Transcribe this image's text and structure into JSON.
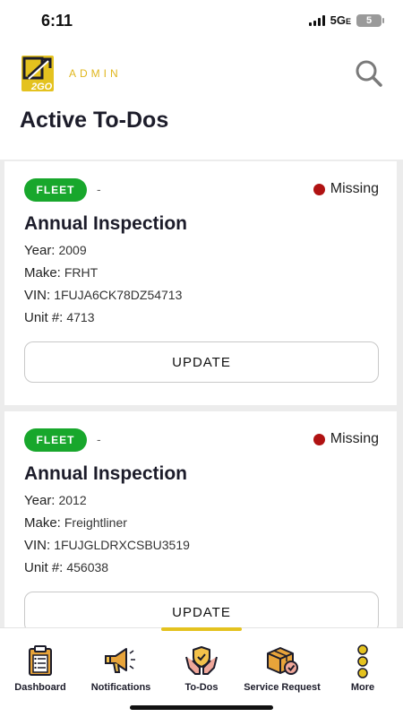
{
  "status_bar": {
    "time": "6:11",
    "network": "5G",
    "network_suffix": "E",
    "battery": "5"
  },
  "header": {
    "logo_text": "2GO",
    "admin_label": "ADMIN",
    "title": "Active To-Dos",
    "search_icon": "search-icon"
  },
  "colors": {
    "accent": "#e4c21f",
    "badge_green": "#18a72c",
    "status_red": "#b01212"
  },
  "labels": {
    "year": "Year:",
    "make": "Make:",
    "vin": "VIN:",
    "unit": "Unit #:"
  },
  "todos": [
    {
      "badge": "FLEET",
      "dash": "-",
      "status": "Missing",
      "title": "Annual Inspection",
      "year": "2009",
      "make": "FRHT",
      "vin": "1FUJA6CK78DZ54713",
      "unit": "4713",
      "button": "UPDATE"
    },
    {
      "badge": "FLEET",
      "dash": "-",
      "status": "Missing",
      "title": "Annual Inspection",
      "year": "2012",
      "make": "Freightliner",
      "vin": "1FUJGLDRXCSBU3519",
      "unit": "456038",
      "button": "UPDATE"
    }
  ],
  "tabs": [
    {
      "label": "Dashboard",
      "icon": "clipboard-icon"
    },
    {
      "label": "Notifications",
      "icon": "megaphone-icon"
    },
    {
      "label": "To-Dos",
      "icon": "hands-shield-icon",
      "active": true
    },
    {
      "label": "Service Request",
      "icon": "box-check-icon"
    },
    {
      "label": "More",
      "icon": "dots-vertical-icon"
    }
  ]
}
